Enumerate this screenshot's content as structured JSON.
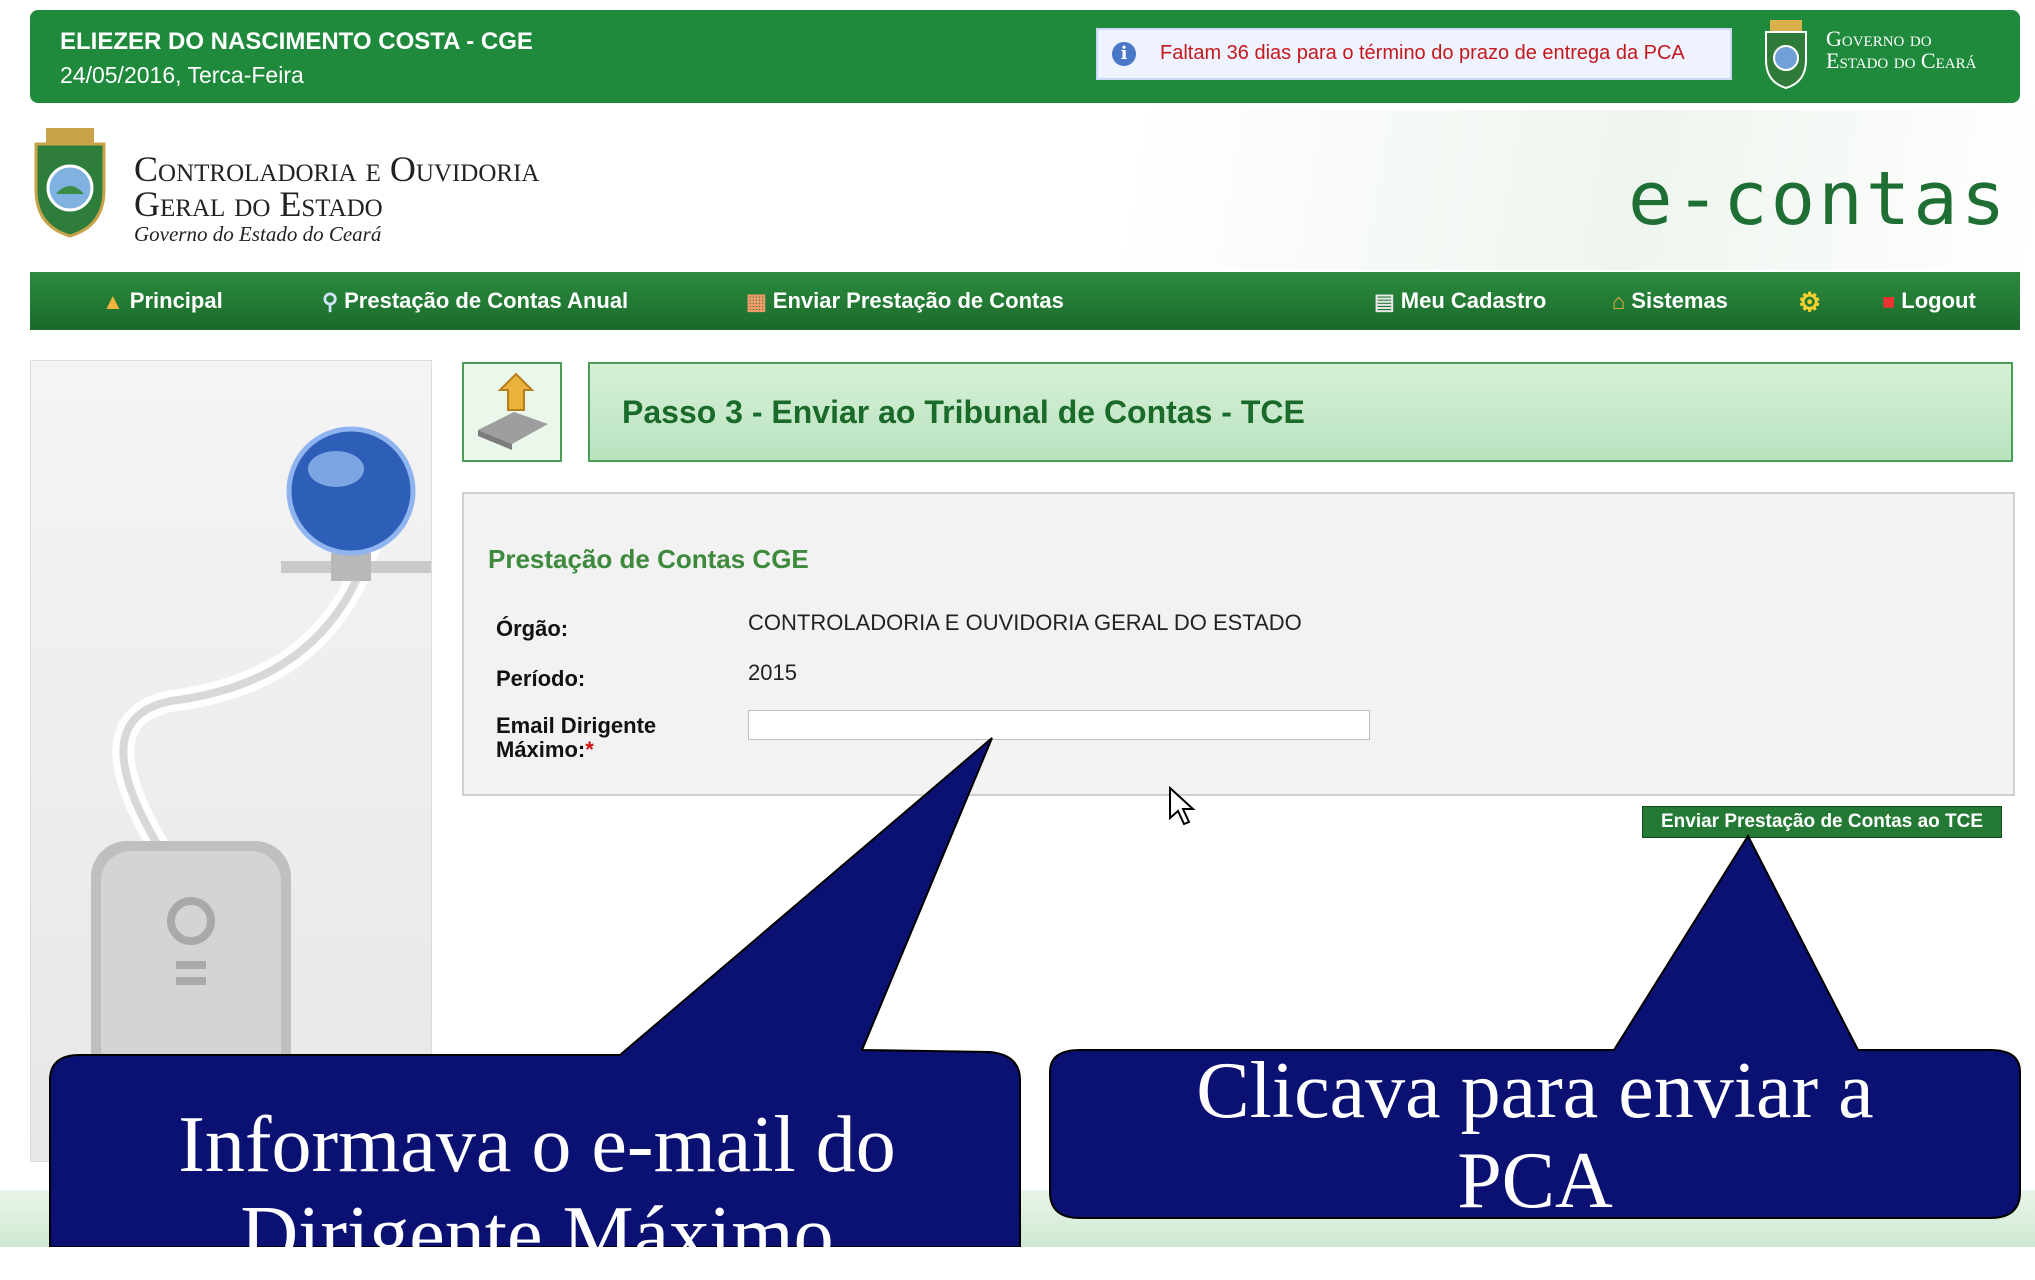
{
  "topbar": {
    "user_name": "ELIEZER DO NASCIMENTO COSTA - CGE",
    "date": "24/05/2016, Terca-Feira",
    "notice": "Faltam 36 dias para o término do prazo de entrega da PCA",
    "gov_line1": "Governo do",
    "gov_line2": "Estado do Ceará"
  },
  "header": {
    "org_line1": "Controladoria e Ouvidoria",
    "org_line2": "Geral do Estado",
    "org_line3": "Governo do Estado do Ceará",
    "brand": "e-contas"
  },
  "nav": {
    "principal": "Principal",
    "pca": "Prestação de Contas Anual",
    "enviar": "Enviar Prestação de Contas",
    "cadastro": "Meu Cadastro",
    "sistemas": "Sistemas",
    "logout": "Logout"
  },
  "step": {
    "title": "Passo 3 - Enviar ao Tribunal de Contas - TCE"
  },
  "form": {
    "title": "Prestação de Contas CGE",
    "orgao_label": "Órgão:",
    "orgao_value": "CONTROLADORIA E OUVIDORIA GERAL DO ESTADO",
    "periodo_label": "Período:",
    "periodo_value": "2015",
    "email_label_1": "Email Dirigente",
    "email_label_2": "Máximo:",
    "required_mark": "*",
    "email_value": "",
    "submit_label": "Enviar Prestação de Contas ao TCE"
  },
  "callouts": {
    "left_line1": "Informava o e-mail do",
    "left_line2": "Dirigente Máximo",
    "right_line1": "Clicava para enviar a",
    "right_line2": "PCA"
  },
  "colors": {
    "green_dark": "#1f8a3b",
    "callout_fill": "#0b1172",
    "notice_text": "#c4181b"
  }
}
